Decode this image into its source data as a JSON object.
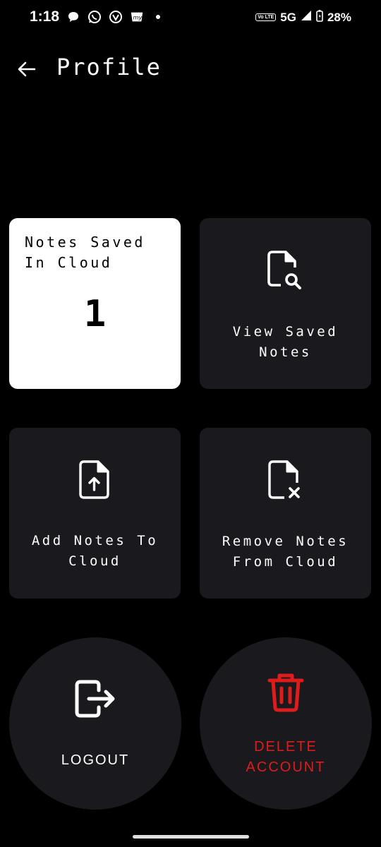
{
  "status_bar": {
    "time": "1:18",
    "volte": "Vo LTE",
    "network": "5G",
    "battery": "28%",
    "notification_icons": [
      "chat-bubble-icon",
      "whatsapp-icon",
      "vpn-icon",
      "myjio-icon",
      "dot-icon"
    ]
  },
  "header": {
    "back_icon": "arrow-left-icon",
    "title": "Profile"
  },
  "tiles": {
    "notes_saved": {
      "label": "Notes Saved\nIn Cloud",
      "count": "1"
    },
    "view_saved": {
      "label": "View Saved\nNotes",
      "icon": "file-search-icon"
    },
    "add_notes": {
      "label": "Add Notes To\nCloud",
      "icon": "file-upload-icon"
    },
    "remove_notes": {
      "label": "Remove Notes\nFrom Cloud",
      "icon": "file-remove-icon"
    }
  },
  "actions": {
    "logout": {
      "label": "LOGOUT",
      "icon": "logout-icon"
    },
    "delete_account": {
      "label": "DELETE\nACCOUNT",
      "icon": "trash-icon",
      "color": "#e01b1b"
    }
  },
  "colors": {
    "background": "#000000",
    "tile": "#1a1a1e",
    "tile_highlight": "#ffffff",
    "danger": "#e01b1b"
  }
}
